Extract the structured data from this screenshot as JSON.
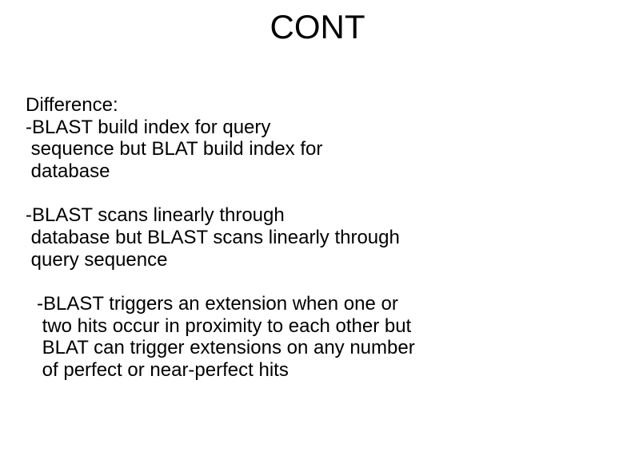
{
  "title": "CONT",
  "para1_l1": "Difference:",
  "para1_l2": "-BLAST build index for query",
  "para1_l3": " sequence but BLAT build index for",
  "para1_l4": " database",
  "para2_l1": "-BLAST scans linearly through",
  "para2_l2": " database but BLAST scans linearly through",
  "para2_l3": " query sequence",
  "para3_l1": "-BLAST triggers an extension when one or",
  "para3_l2": " two hits occur in proximity to each other but",
  "para3_l3": " BLAT can trigger extensions on any number",
  "para3_l4": " of perfect or near-perfect hits"
}
